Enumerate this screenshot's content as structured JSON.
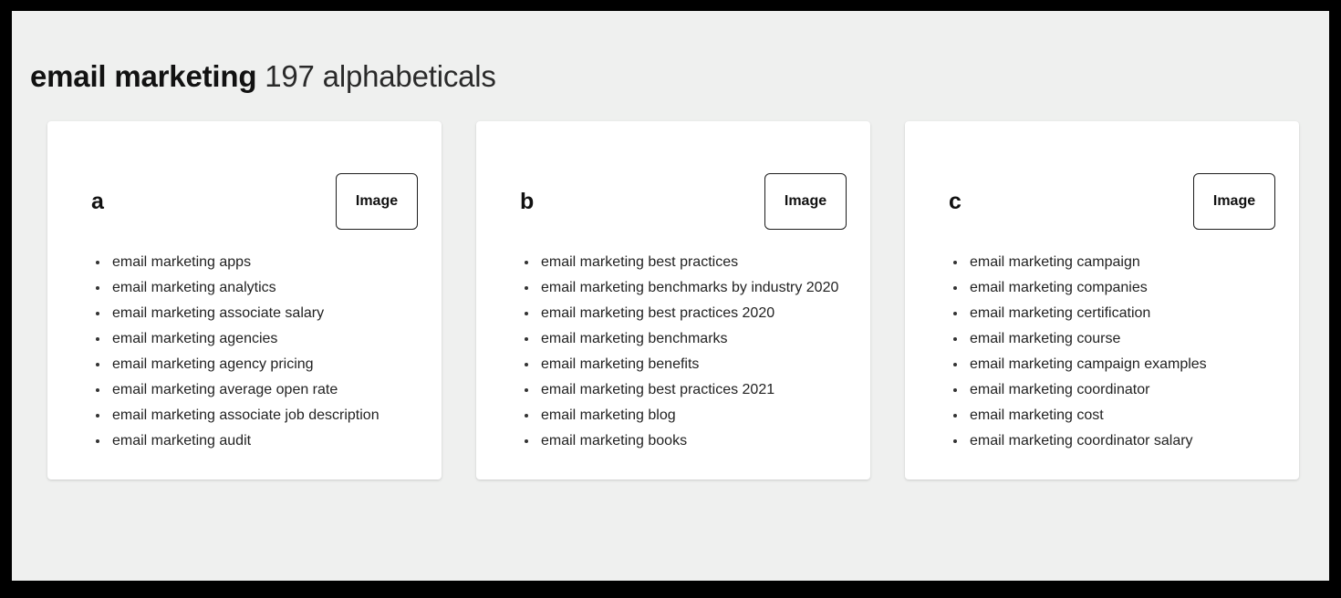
{
  "header": {
    "keyword": "email marketing",
    "count_label": "197 alphabeticals"
  },
  "image_placeholder_label": "Image",
  "cards": [
    {
      "letter": "a",
      "image_label": "Image",
      "items": [
        "email marketing apps",
        "email marketing analytics",
        "email marketing associate salary",
        "email marketing agencies",
        "email marketing agency pricing",
        "email marketing average open rate",
        "email marketing associate job description",
        "email marketing audit"
      ]
    },
    {
      "letter": "b",
      "image_label": "Image",
      "items": [
        "email marketing best practices",
        "email marketing benchmarks by industry 2020",
        "email marketing best practices 2020",
        "email marketing benchmarks",
        "email marketing benefits",
        "email marketing best practices 2021",
        "email marketing blog",
        "email marketing books"
      ]
    },
    {
      "letter": "c",
      "image_label": "Image",
      "items": [
        "email marketing campaign",
        "email marketing companies",
        "email marketing certification",
        "email marketing course",
        "email marketing campaign examples",
        "email marketing coordinator",
        "email marketing cost",
        "email marketing coordinator salary"
      ]
    }
  ],
  "colors": {
    "page_background": "#eff0ef",
    "card_background": "#ffffff",
    "text": "#222222",
    "frame": "#000000"
  }
}
